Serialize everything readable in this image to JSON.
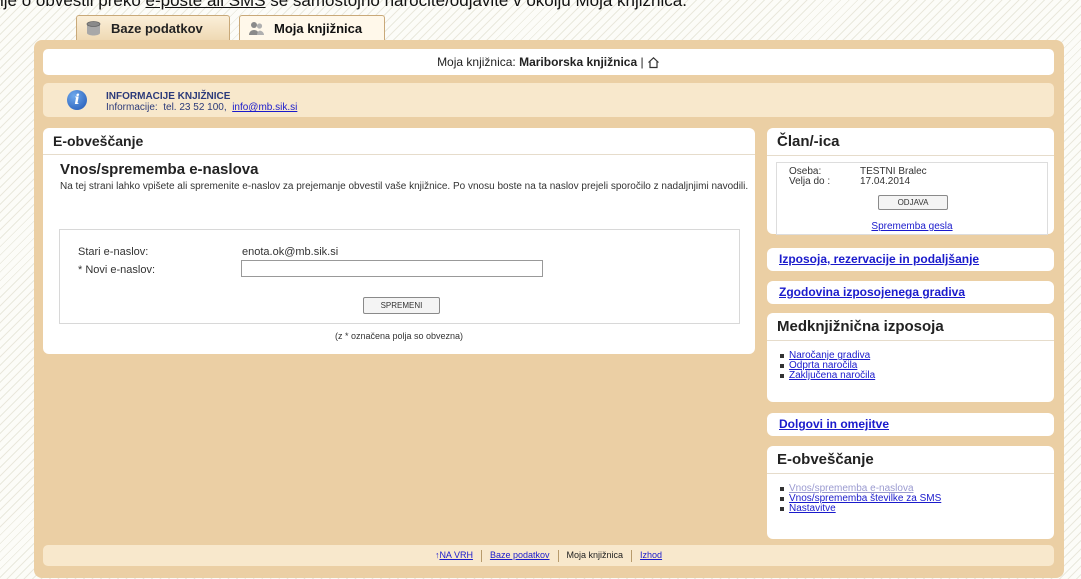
{
  "banner": {
    "text": "ije o obvestil preko ",
    "link": "e-pošte ali SMS",
    "text2": " se samostojno naročite/odjavite v okolju Moja knjižnica."
  },
  "tabs": [
    {
      "label": "Baze podatkov",
      "icon": "database-icon"
    },
    {
      "label": "Moja knjižnica",
      "icon": "users-icon",
      "active": true
    }
  ],
  "library_bar": {
    "prefix": "Moja knjižnica: ",
    "library": "Mariborska knjižnica",
    "separator": " | ",
    "icon": "home-icon"
  },
  "info": {
    "title": "INFORMACIJE KNJIŽNICE",
    "line_prefix": "Informacije:  tel. 23 52 100,  ",
    "email": "info@mb.sik.si"
  },
  "main": {
    "heading": "E-obveščanje",
    "subtitle": "Vnos/sprememba e-naslova",
    "description": "Na tej strani lahko vpišete ali spremenite e-naslov za prejemanje obvestil vaše knjižnice. Po vnosu boste na ta naslov prejeli sporočilo z nadaljnjimi navodili.",
    "old_email_label": "Stari e-naslov:",
    "old_email_value": "enota.ok@mb.sik.si",
    "new_email_label": "* Novi e-naslov:",
    "new_email_value": "",
    "save_label": "SPREMENI",
    "required_note": "(z * označena polja so obvezna)"
  },
  "member": {
    "heading": "Član/-ica",
    "person_label": "Oseba:",
    "person_value": "TESTNI Bralec",
    "valid_label": "Velja do :",
    "valid_value": "17.04.2014",
    "logout_label": "ODJAVA",
    "password_link": "Sprememba gesla"
  },
  "side_links": {
    "loans": "Izposoja, rezervacije in podaljšanje",
    "history": "Zgodovina izposojenega gradiva",
    "debts": "Dolgovi in omejitve"
  },
  "ill": {
    "heading": "Medknjižnična izposoja",
    "items": [
      "Naročanje gradiva",
      "Odprta naročila",
      "Zaključena naročila"
    ]
  },
  "notify": {
    "heading": "E-obveščanje",
    "items": [
      "Vnos/sprememba e-naslova",
      "Vnos/sprememba številke za SMS",
      "Nastavitve"
    ]
  },
  "footer": {
    "top": "NA VRH",
    "databases": "Baze podatkov",
    "my_library": "Moja knjižnica",
    "exit": "Izhod"
  },
  "colors": {
    "frame": "#ebcfa4",
    "info_bg": "#f8e8cc",
    "link": "#1a1acc"
  }
}
